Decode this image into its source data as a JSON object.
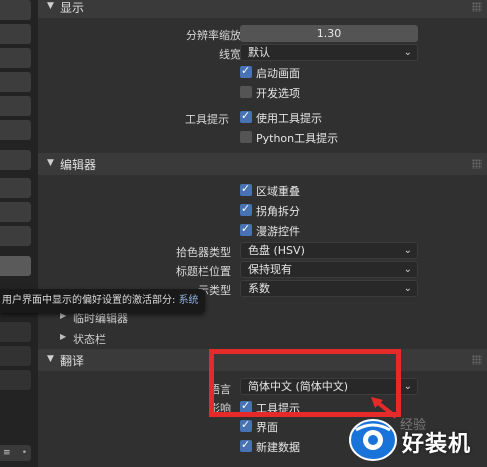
{
  "sidebar": {
    "bottom_label": "≡",
    "bottom_dot": "•"
  },
  "display": {
    "title": "显示",
    "resolution_label": "分辨率缩放",
    "resolution_value": "1.30",
    "line_width_label": "线宽",
    "line_width_value": "默认",
    "splash_label": "启动画面",
    "splash_checked": true,
    "dev_label": "开发选项",
    "dev_checked": false,
    "tooltips_label": "工具提示",
    "use_tooltips_label": "使用工具提示",
    "use_tooltips_checked": true,
    "python_tooltips_label": "Python工具提示",
    "python_tooltips_checked": false
  },
  "editors": {
    "title": "编辑器",
    "region_overlap_label": "区域重叠",
    "region_overlap_checked": true,
    "corner_split_label": "拐角拆分",
    "corner_split_checked": true,
    "nav_controls_label": "漫游控件",
    "nav_controls_checked": true,
    "color_picker_label": "拾色器类型",
    "color_picker_value": "色盘 (HSV)",
    "header_pos_label": "标题栏位置",
    "header_pos_value": "保持现有",
    "factor_label_partial": "示类型",
    "factor_value": "系数",
    "sub_timeline": "临时编辑器",
    "sub_statusbar": "状态栏"
  },
  "translation": {
    "title": "翻译",
    "language_label": "语言",
    "language_value": "简体中文 (简体中文)",
    "affect_label": "影响",
    "affect_tooltips_label": "工具提示",
    "affect_tooltips_checked": true,
    "interface_label": "界面",
    "interface_checked": true,
    "new_data_label": "新建数据",
    "new_data_checked": true
  },
  "tooltip": {
    "text": "用户界面中显示的偏好设置的激活部分: ",
    "link": "系统"
  },
  "watermark": {
    "text": "好装机",
    "faint": "经验"
  },
  "colors": {
    "accent": "#4772b3",
    "highlight": "#e62a2a",
    "panel": "#303030",
    "header": "#3a3a3a"
  }
}
